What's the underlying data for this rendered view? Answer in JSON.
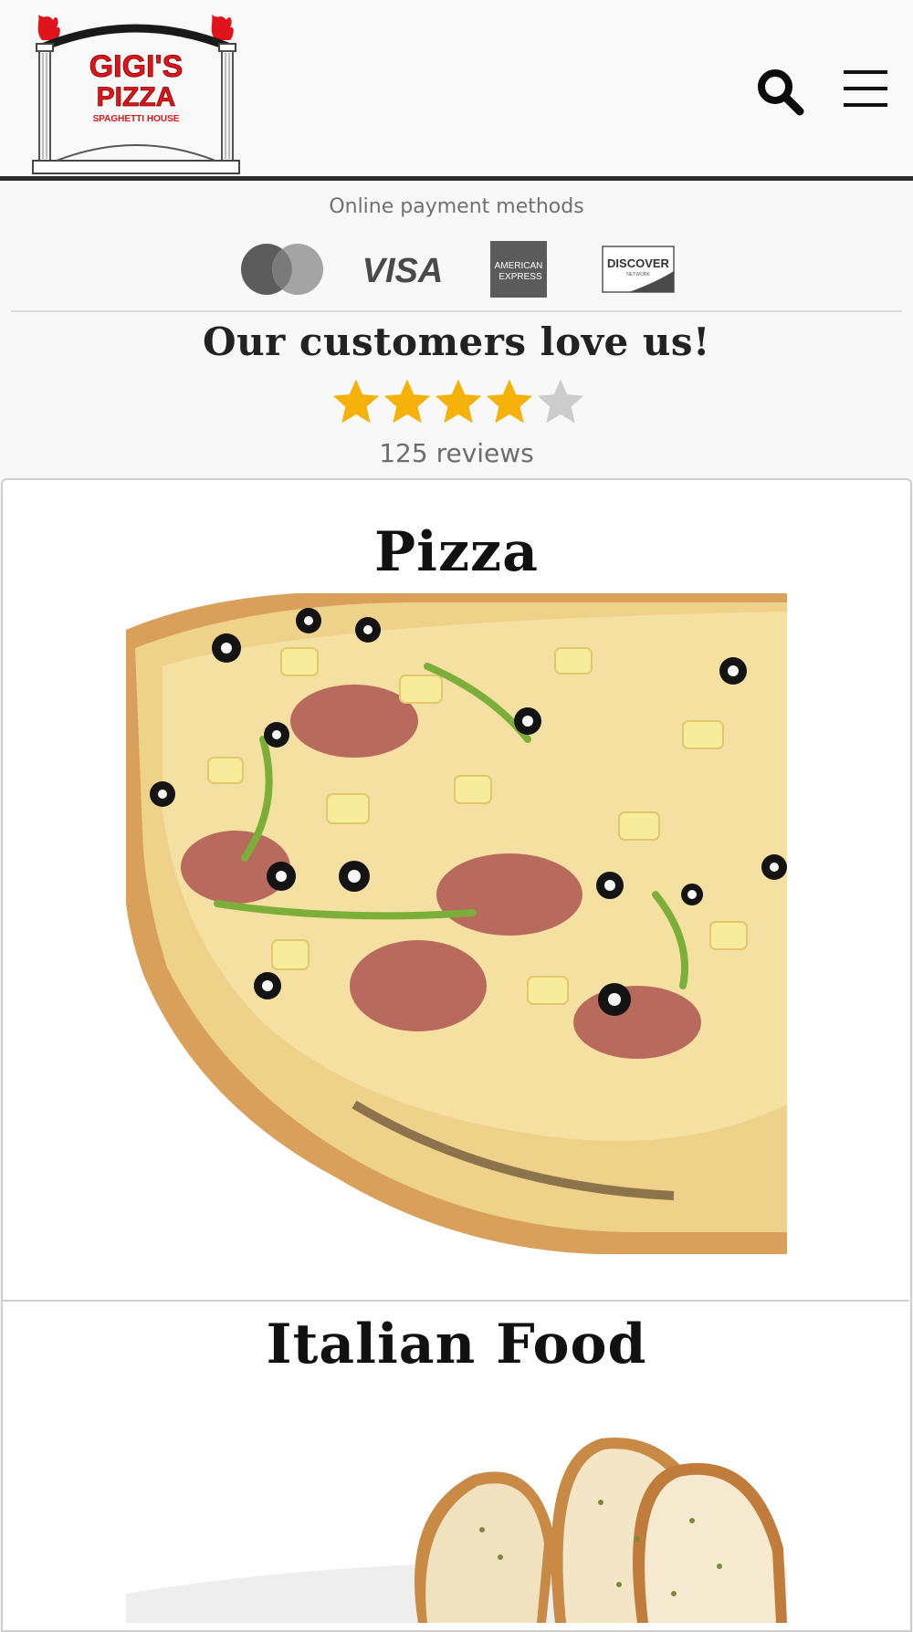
{
  "brand": {
    "logo_line1": "GIGI'S",
    "logo_line2": "PIZZA",
    "logo_line3": "SPAGHETTI HOUSE"
  },
  "header": {
    "search_icon": "search-icon",
    "menu_icon": "hamburger-menu-icon"
  },
  "payment": {
    "label": "Online payment methods",
    "cards": [
      {
        "name": "mastercard",
        "label": ""
      },
      {
        "name": "visa",
        "label": "VISA"
      },
      {
        "name": "american-express",
        "label": "AMERICAN EXPRESS"
      },
      {
        "name": "discover",
        "label": "DISCOVER"
      }
    ]
  },
  "reviews": {
    "heading": "Our customers love us!",
    "rating": 4,
    "max_rating": 5,
    "count_text": "125 reviews"
  },
  "categories": [
    {
      "title": "Pizza"
    },
    {
      "title": "Italian Food"
    }
  ],
  "colors": {
    "brand_red": "#e0141b",
    "star_gold": "#f5b20a",
    "star_empty": "#cccccc",
    "dark": "#2b2b2b"
  }
}
